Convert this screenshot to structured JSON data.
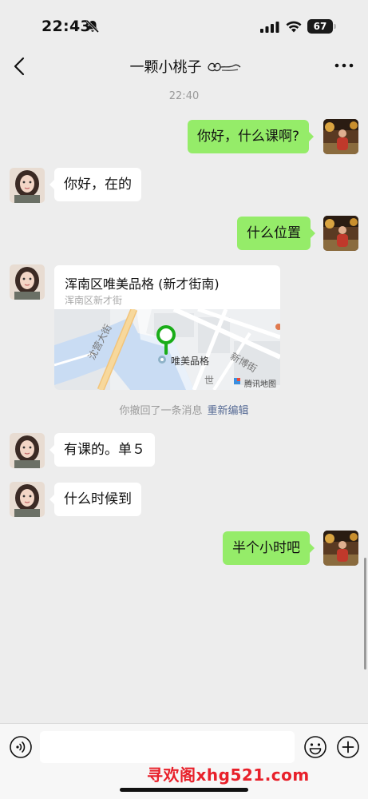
{
  "status_bar": {
    "time": "22:43",
    "battery": "67",
    "icons": [
      "mute-bell-icon",
      "cellular-signal-icon",
      "wifi-icon",
      "battery-icon"
    ]
  },
  "nav": {
    "title": "一颗小桃子",
    "back_icon": "chevron-left-icon",
    "more_icon": "ellipsis-icon"
  },
  "timestamp": "22:40",
  "messages": [
    {
      "side": "right",
      "text": "你好，什么课啊?"
    },
    {
      "side": "left",
      "text": "你好，在的"
    },
    {
      "side": "right",
      "text": "什么位置"
    },
    {
      "side": "left",
      "type": "location"
    },
    {
      "side": "left",
      "text": "有课的。单５"
    },
    {
      "side": "left",
      "text": "什么时候到"
    },
    {
      "side": "right",
      "text": "半个小时吧"
    }
  ],
  "location": {
    "title": "浑南区唯美品格 (新才街南)",
    "address": "浑南区新才街",
    "map_place": "唯美品格",
    "map_streets": [
      "沈营大街",
      "新博街",
      "世"
    ],
    "map_provider": "腾讯地图"
  },
  "recall": {
    "note": "你撤回了一条消息",
    "edit": "重新编辑"
  },
  "input_bar": {
    "placeholder": "",
    "icons": [
      "voice-icon",
      "emoji-icon",
      "plus-icon"
    ]
  },
  "watermark": "寻欢阁xhg521.com",
  "colors": {
    "background": "#ededed",
    "green_bubble": "#95ec69",
    "white_bubble": "#ffffff",
    "link": "#576b95",
    "watermark": "#e8202a",
    "map_pin": "#1aad19"
  }
}
